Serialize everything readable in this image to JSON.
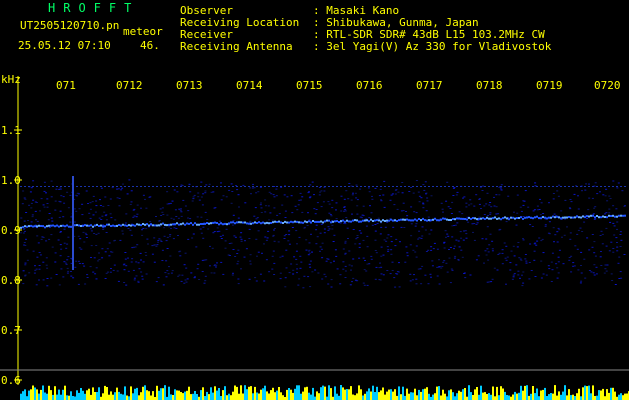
{
  "header": {
    "brand": "HROFFT",
    "filename": "UT2505120710.pn",
    "meteor_label": "meteor",
    "datetime": "25.05.12 07:10",
    "count": "46.",
    "fields": [
      {
        "label": "Observer",
        "value": ": Masaki Kano"
      },
      {
        "label": "Receiving Location",
        "value": ": Shibukawa, Gunma, Japan"
      },
      {
        "label": "Receiver",
        "value": ": RTL-SDR SDR# 43dB L15 103.2MHz CW"
      },
      {
        "label": "Receiving Antenna",
        "value": ": 3el Yagi(V) Az 330 for Vladivostok"
      }
    ]
  },
  "axis": {
    "unit": "kHz",
    "y_ticks": [
      "1.1",
      "1.0",
      "0.9",
      "0.8",
      "0.7",
      "0.6"
    ],
    "x_ticks": [
      "071",
      "0712",
      "0713",
      "0714",
      "0715",
      "0716",
      "0717",
      "0718",
      "0719",
      "0720"
    ]
  },
  "colors": {
    "text": "#ffff00",
    "brand": "#00ff66",
    "background": "#000000"
  }
}
